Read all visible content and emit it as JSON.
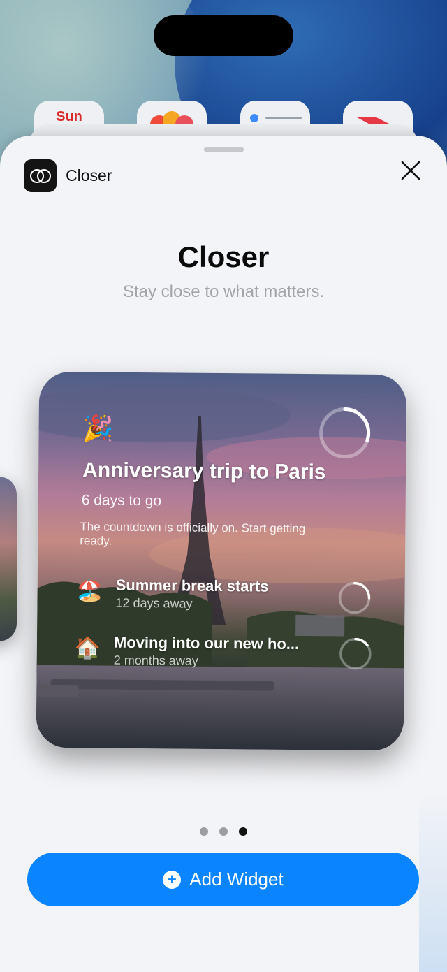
{
  "home": {
    "calendar_day": "Sun"
  },
  "sheet": {
    "app_name": "Closer",
    "app_icon": "closer-app-icon",
    "close_icon": "close-icon",
    "title": "Closer",
    "subtitle": "Stay close to what matters."
  },
  "widget": {
    "main_event": {
      "emoji": "🎉",
      "title": "Anniversary trip to Paris",
      "countdown": "6 days to go",
      "description": "The countdown is officially on. Start getting ready.",
      "progress": 0.3
    },
    "upcoming": [
      {
        "emoji": "🏖️",
        "title": "Summer break starts",
        "subtitle": "12 days away",
        "progress": 0.25
      },
      {
        "emoji": "🏠",
        "title": "Moving into our new ho...",
        "subtitle": "2 months away",
        "progress": 0.15
      }
    ]
  },
  "pagination": {
    "total": 3,
    "current": 3
  },
  "add_button": {
    "label": "Add Widget",
    "icon": "plus-circle-icon"
  },
  "colors": {
    "accent": "#0a84ff",
    "sheet_bg": "#f3f4f7"
  }
}
